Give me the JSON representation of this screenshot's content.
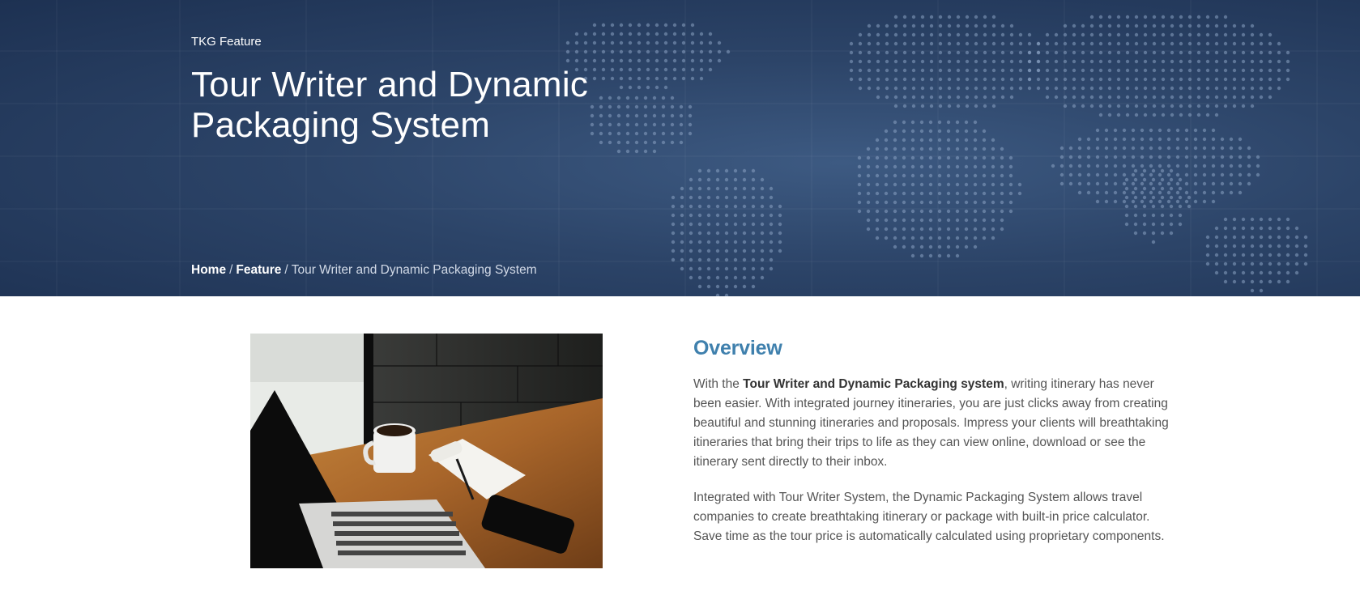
{
  "hero": {
    "kicker": "TKG Feature",
    "title": "Tour Writer and Dynamic Packaging System",
    "background_color": "#2c4468"
  },
  "breadcrumb": {
    "home": "Home",
    "sep1": "/",
    "feature": "Feature",
    "sep2": "/",
    "current": "Tour Writer and Dynamic Packaging System"
  },
  "overview": {
    "heading": "Overview",
    "p1_lead": "With the ",
    "p1_bold": "Tour Writer and Dynamic Packaging system",
    "p1_rest": ", writing itinerary has never been easier. With integrated journey itineraries, you are just clicks away from creating beautiful and stunning itineraries and proposals. Impress your clients will breathtaking itineraries that bring their trips to life as they can view online, download or see the itinerary sent directly to their inbox.",
    "p2": "Integrated with Tour Writer System, the Dynamic Packaging System allows travel companies to create breathtaking itinerary or package with built-in price calculator. Save time as the tour price is automatically calculated using proprietary components.",
    "heading_color": "#3f80ad"
  },
  "image": {
    "subject": "laptop, coffee mug, notepad and phone on a wooden desk"
  }
}
